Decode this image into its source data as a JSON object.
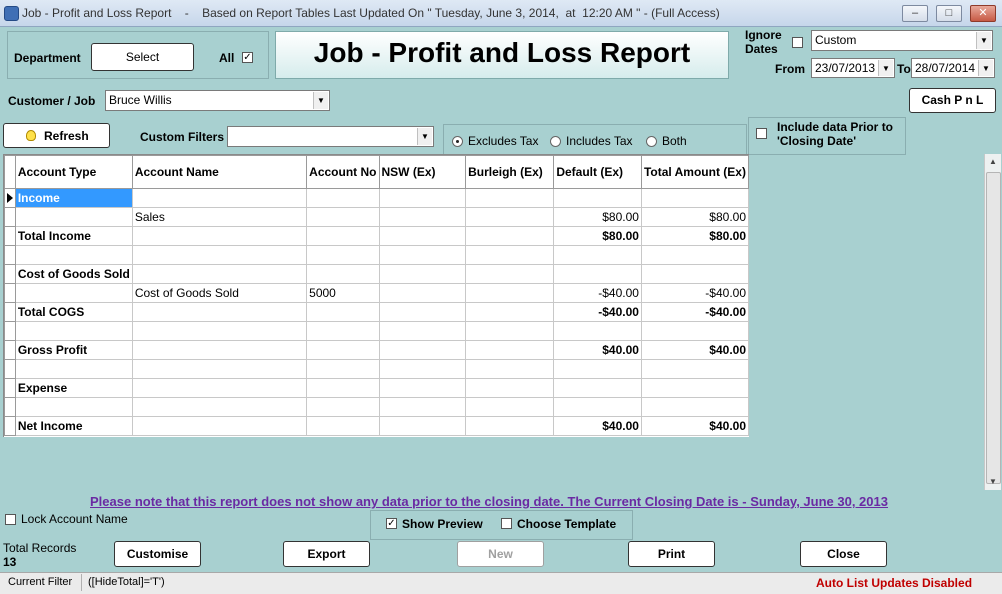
{
  "window": {
    "title": "Job - Profit and Loss Report    -    Based on Report Tables Last Updated On \" Tuesday, June 3, 2014,  at  12:20 AM \" - (Full Access)"
  },
  "header": {
    "department_label": "Department",
    "department_button": "Select",
    "all_label": "All",
    "all_checked": true,
    "report_title": "Job - Profit and Loss Report",
    "ignore_dates_label": "Ignore Dates",
    "ignore_dates_checked": false,
    "date_range_value": "Custom",
    "from_label": "From",
    "from_value": "23/07/2013",
    "to_label": "To",
    "to_value": "28/07/2014"
  },
  "customer": {
    "label": "Customer / Job",
    "value": "Bruce Willis",
    "cash_button": "Cash P n L"
  },
  "filters": {
    "refresh_button": "Refresh",
    "custom_filters_label": "Custom Filters",
    "custom_filters_value": "",
    "tax_options": [
      "Excludes Tax",
      "Includes Tax",
      "Both"
    ],
    "tax_selected": "Excludes Tax",
    "include_prior_label": "Include data Prior to 'Closing Date'",
    "include_prior_checked": false
  },
  "grid": {
    "columns": [
      "Account Type",
      "Account Name",
      "Account No",
      "NSW (Ex)",
      "Burleigh (Ex)",
      "Default (Ex)",
      "Total Amount (Ex)"
    ],
    "rows": [
      {
        "cells": [
          "Income",
          "",
          "",
          "",
          "",
          "",
          ""
        ],
        "bold": true,
        "selected": true
      },
      {
        "cells": [
          "",
          "Sales",
          "",
          "",
          "",
          "$80.00",
          "$80.00"
        ],
        "bold": false
      },
      {
        "cells": [
          "Total Income",
          "",
          "",
          "",
          "",
          "$80.00",
          "$80.00"
        ],
        "bold": true
      },
      {
        "cells": [
          "",
          "",
          "",
          "",
          "",
          "",
          ""
        ],
        "bold": false
      },
      {
        "cells": [
          "Cost of Goods Sold",
          "",
          "",
          "",
          "",
          "",
          ""
        ],
        "bold": true
      },
      {
        "cells": [
          "",
          "Cost of Goods Sold",
          "5000",
          "",
          "",
          "-$40.00",
          "-$40.00"
        ],
        "bold": false
      },
      {
        "cells": [
          "Total COGS",
          "",
          "",
          "",
          "",
          "-$40.00",
          "-$40.00"
        ],
        "bold": true
      },
      {
        "cells": [
          "",
          "",
          "",
          "",
          "",
          "",
          ""
        ],
        "bold": false
      },
      {
        "cells": [
          "Gross Profit",
          "",
          "",
          "",
          "",
          "$40.00",
          "$40.00"
        ],
        "bold": true
      },
      {
        "cells": [
          "",
          "",
          "",
          "",
          "",
          "",
          ""
        ],
        "bold": false
      },
      {
        "cells": [
          "Expense",
          "",
          "",
          "",
          "",
          "",
          ""
        ],
        "bold": true
      },
      {
        "cells": [
          "",
          "",
          "",
          "",
          "",
          "",
          ""
        ],
        "bold": false
      },
      {
        "cells": [
          "Net Income",
          "",
          "",
          "",
          "",
          "$40.00",
          "$40.00"
        ],
        "bold": true
      }
    ]
  },
  "note": "Please note that this report does not show any data prior to the closing date.   The Current Closing Date is - Sunday, June 30, 2013",
  "options": {
    "lock_account_name_label": "Lock Account Name",
    "lock_account_name_checked": false,
    "show_preview_label": "Show Preview",
    "show_preview_checked": true,
    "choose_template_label": "Choose Template",
    "choose_template_checked": false
  },
  "footer": {
    "total_records_label": "Total Records",
    "total_records_value": "13",
    "customise_button": "Customise",
    "export_button": "Export",
    "new_button": "New",
    "print_button": "Print",
    "close_button": "Close"
  },
  "statusbar": {
    "current_filter_label": "Current Filter",
    "current_filter_value": "([HideTotal]='T')",
    "auto_list_status": "Auto List Updates Disabled"
  },
  "colors": {
    "background": "#a8d0d0",
    "selection": "#3399ff",
    "note_text": "#6a2aa3",
    "status_warning": "#c00000"
  }
}
